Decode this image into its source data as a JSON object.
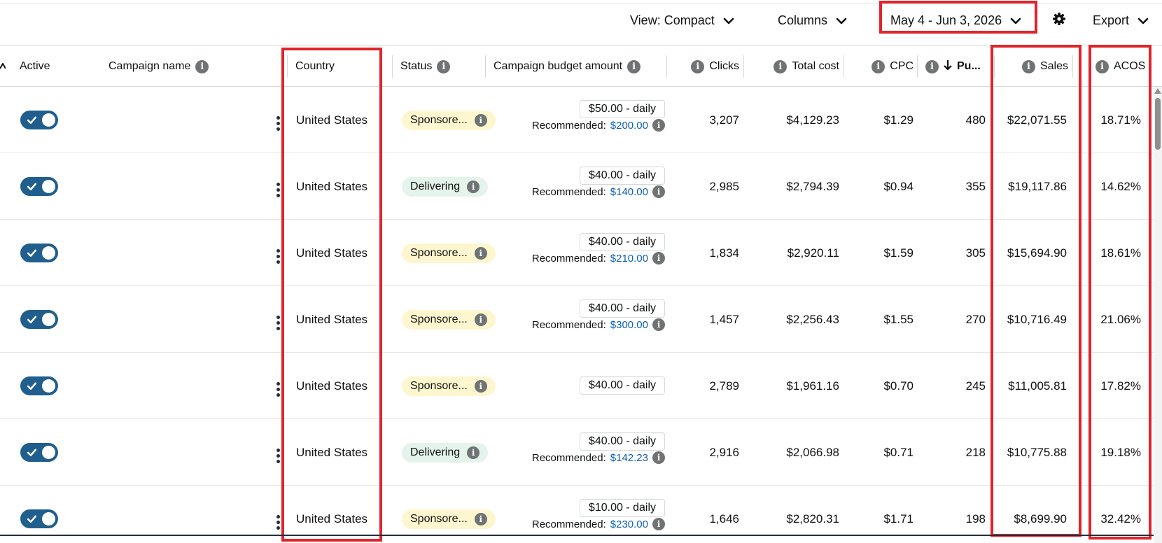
{
  "toolbar": {
    "view_label": "View: Compact",
    "columns_label": "Columns",
    "date_range": "May 4 - Jun 3, 2026",
    "export_label": "Export"
  },
  "columns": {
    "active": "Active",
    "campaign_name": "Campaign name",
    "country": "Country",
    "status": "Status",
    "budget": "Campaign budget amount",
    "clicks": "Clicks",
    "total_cost": "Total cost",
    "cpc": "CPC",
    "purchases": "Pu...",
    "sales": "Sales",
    "acos": "ACOS"
  },
  "recommended_label": "Recommended:",
  "rows": [
    {
      "active": true,
      "campaign_name": "",
      "country": "United States",
      "status": "Sponsore...",
      "status_type": "sponsored",
      "budget": "$50.00 - daily",
      "recommended": "$200.00",
      "clicks": "3,207",
      "total_cost": "$4,129.23",
      "cpc": "$1.29",
      "purchases": "480",
      "sales": "$22,071.55",
      "acos": "18.71%"
    },
    {
      "active": true,
      "campaign_name": "",
      "country": "United States",
      "status": "Delivering",
      "status_type": "delivering",
      "budget": "$40.00 - daily",
      "recommended": "$140.00",
      "clicks": "2,985",
      "total_cost": "$2,794.39",
      "cpc": "$0.94",
      "purchases": "355",
      "sales": "$19,117.86",
      "acos": "14.62%"
    },
    {
      "active": true,
      "campaign_name": "",
      "country": "United States",
      "status": "Sponsore...",
      "status_type": "sponsored",
      "budget": "$40.00 - daily",
      "recommended": "$210.00",
      "clicks": "1,834",
      "total_cost": "$2,920.11",
      "cpc": "$1.59",
      "purchases": "305",
      "sales": "$15,694.90",
      "acos": "18.61%"
    },
    {
      "active": true,
      "campaign_name": "",
      "country": "United States",
      "status": "Sponsore...",
      "status_type": "sponsored",
      "budget": "$40.00 - daily",
      "recommended": "$300.00",
      "clicks": "1,457",
      "total_cost": "$2,256.43",
      "cpc": "$1.55",
      "purchases": "270",
      "sales": "$10,716.49",
      "acos": "21.06%"
    },
    {
      "active": true,
      "campaign_name": "",
      "country": "United States",
      "status": "Sponsore...",
      "status_type": "sponsored",
      "budget": "$40.00 - daily",
      "recommended": "",
      "clicks": "2,789",
      "total_cost": "$1,961.16",
      "cpc": "$0.70",
      "purchases": "245",
      "sales": "$11,005.81",
      "acos": "17.82%"
    },
    {
      "active": true,
      "campaign_name": "",
      "country": "United States",
      "status": "Delivering",
      "status_type": "delivering",
      "budget": "$40.00 - daily",
      "recommended": "$142.23",
      "clicks": "2,916",
      "total_cost": "$2,066.98",
      "cpc": "$0.71",
      "purchases": "218",
      "sales": "$10,775.88",
      "acos": "19.18%"
    },
    {
      "active": true,
      "campaign_name": "",
      "country": "United States",
      "status": "Sponsore...",
      "status_type": "sponsored",
      "budget": "$10.00 - daily",
      "recommended": "$230.00",
      "clicks": "1,646",
      "total_cost": "$2,820.31",
      "cpc": "$1.71",
      "purchases": "198",
      "sales": "$8,699.90",
      "acos": "32.42%"
    }
  ],
  "colors": {
    "toggle": "#1f5e8d",
    "highlight": "#e0242a",
    "link": "#0c5fb0",
    "sponsored_badge": "#fdf6cf",
    "delivering_badge": "#e4f4ea"
  },
  "icons": [
    "chevron-down-icon",
    "gear-icon",
    "info-icon",
    "sort-down-arrow-icon",
    "more-options-icon",
    "check-icon"
  ]
}
